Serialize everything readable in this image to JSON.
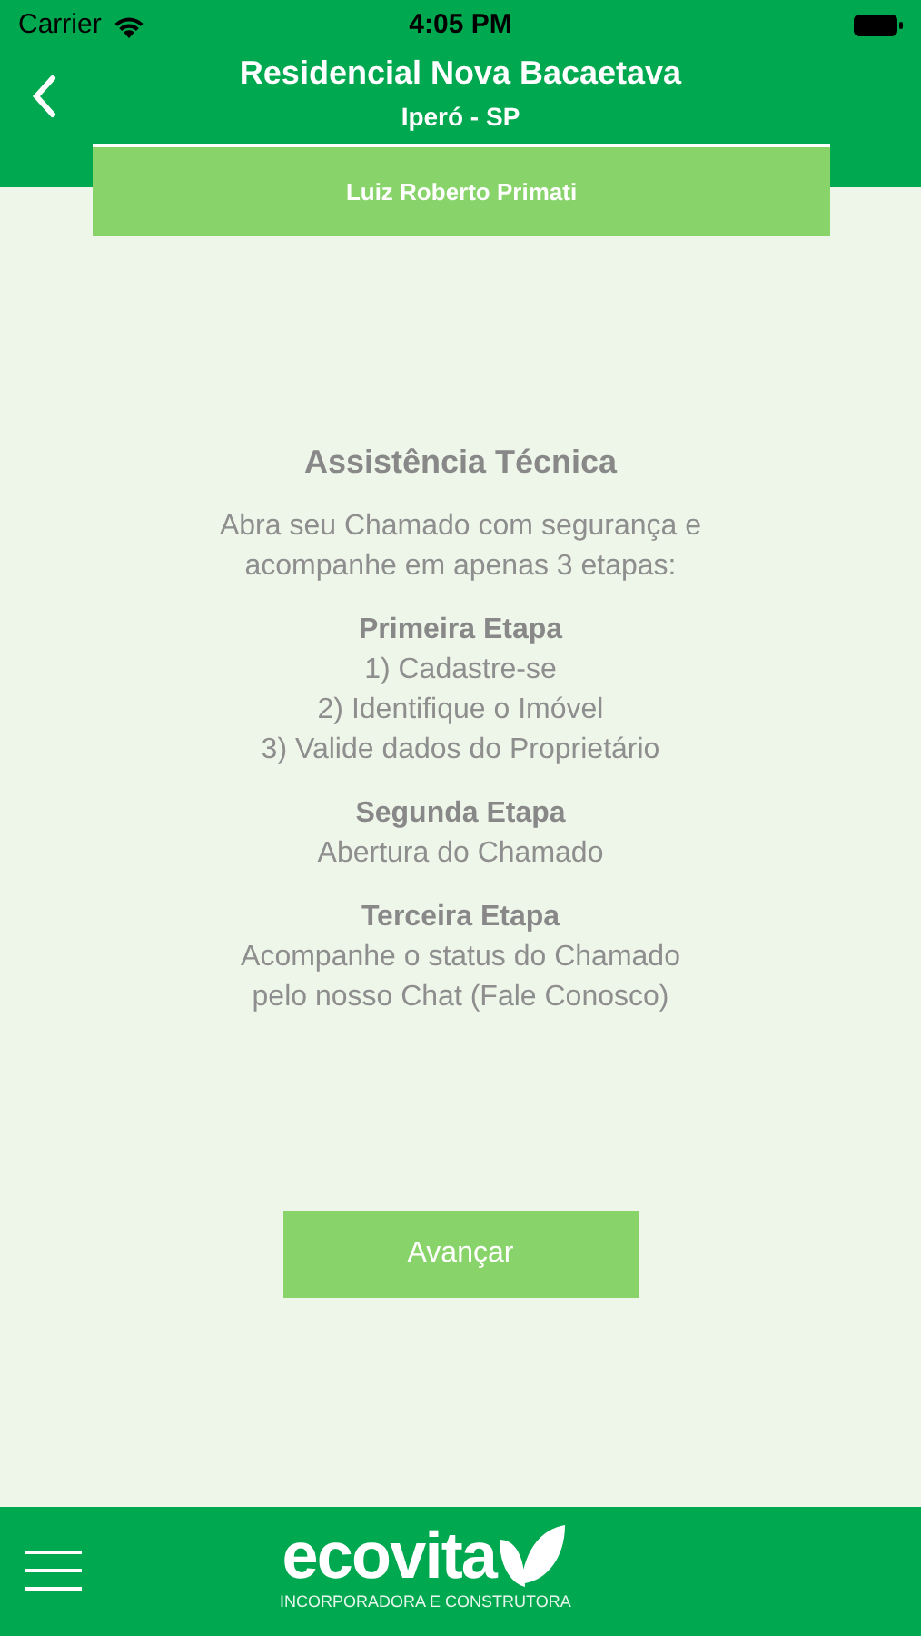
{
  "status_bar": {
    "carrier": "Carrier",
    "time": "4:05 PM"
  },
  "header": {
    "title": "Residencial Nova Bacaetava",
    "subtitle": "Iperó - SP",
    "user": "Luiz Roberto Primati"
  },
  "content": {
    "title": "Assistência Técnica",
    "intro": "Abra seu Chamado com segurança e acompanhe em apenas 3 etapas:",
    "steps": [
      {
        "heading": "Primeira Etapa",
        "lines": [
          "1) Cadastre-se",
          "2) Identifique o Imóvel",
          "3) Valide dados do Proprietário"
        ]
      },
      {
        "heading": "Segunda Etapa",
        "lines": [
          "Abertura do Chamado"
        ]
      },
      {
        "heading": "Terceira Etapa",
        "lines": [
          "Acompanhe o status do Chamado pelo nosso Chat (Fale Conosco)"
        ]
      }
    ]
  },
  "button": "Avançar",
  "footer": {
    "logo": "ecovita",
    "tagline": "INCORPORADORA E CONSTRUTORA"
  }
}
